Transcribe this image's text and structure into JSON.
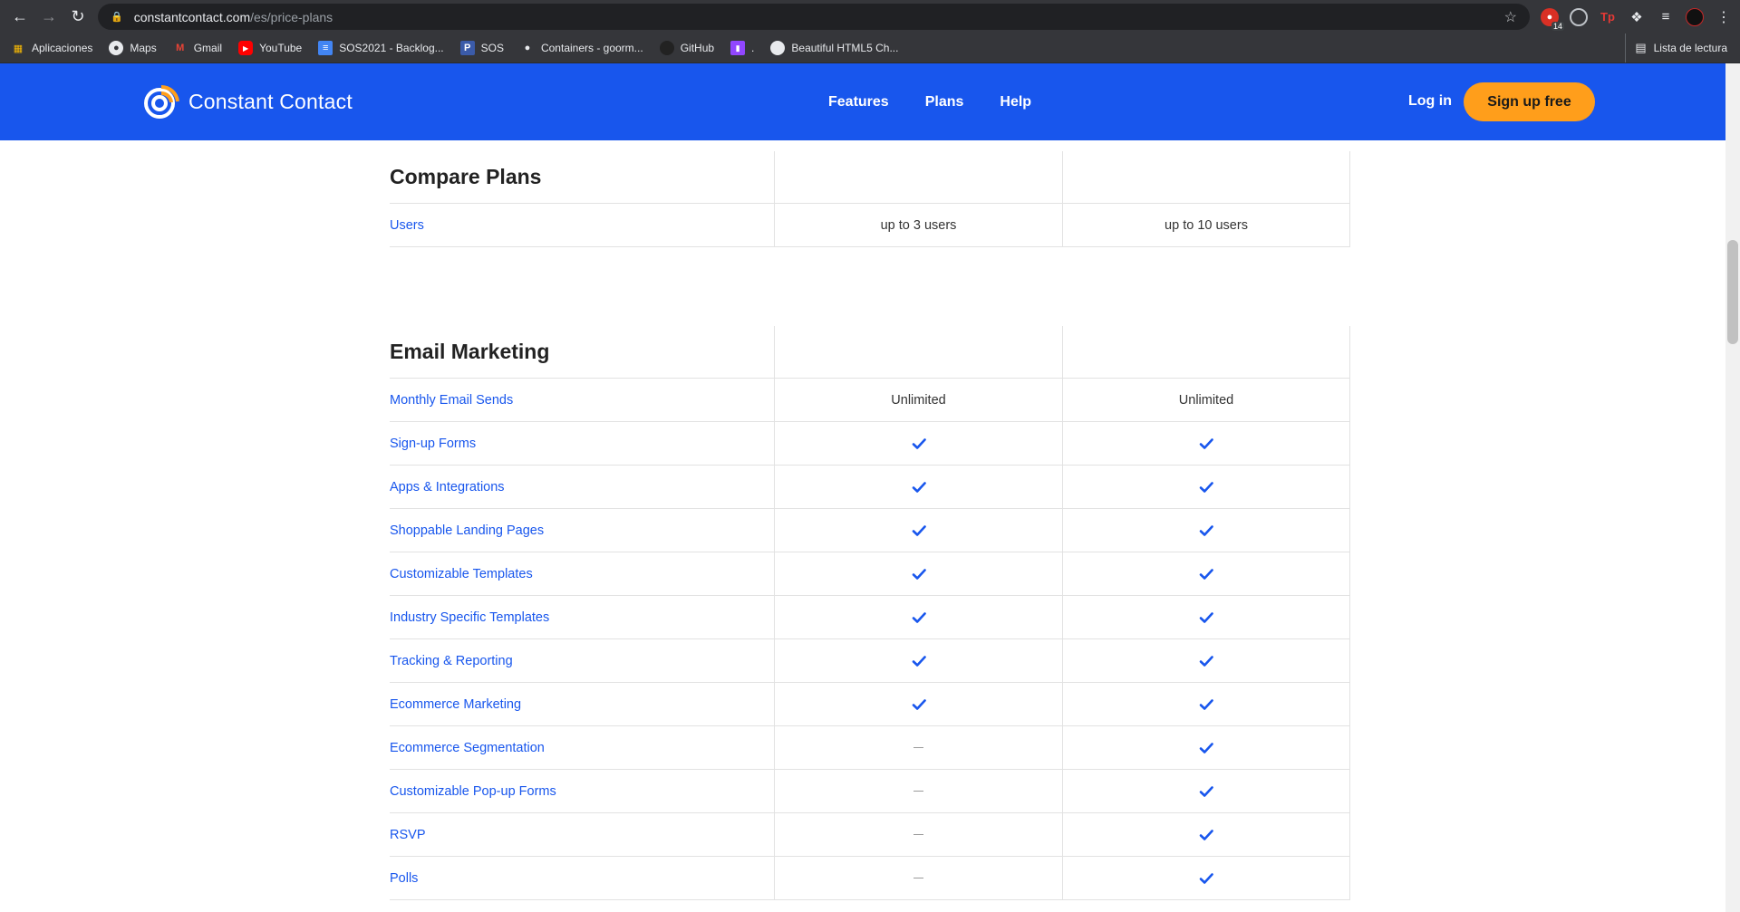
{
  "browser": {
    "url_host": "constantcontact.com",
    "url_path": "/es/price-plans",
    "bookmarks": [
      {
        "label": "Aplicaciones",
        "icon": "apps-grid-icon"
      },
      {
        "label": "Maps",
        "icon": "maps-icon"
      },
      {
        "label": "Gmail",
        "icon": "gmail-icon"
      },
      {
        "label": "YouTube",
        "icon": "youtube-icon"
      },
      {
        "label": "SOS2021 - Backlog...",
        "icon": "doc-icon"
      },
      {
        "label": "SOS",
        "icon": "p-icon"
      },
      {
        "label": "Containers - goorm...",
        "icon": "person-icon"
      },
      {
        "label": "GitHub",
        "icon": "github-icon"
      },
      {
        "label": ".",
        "icon": "twitch-icon"
      },
      {
        "label": "Beautiful HTML5 Ch...",
        "icon": "globe-icon"
      }
    ],
    "extension_badge": "14",
    "reading_list": "Lista de lectura"
  },
  "header": {
    "brand": "Constant Contact",
    "nav": [
      "Features",
      "Plans",
      "Help"
    ],
    "login": "Log in",
    "signup": "Sign up free"
  },
  "compare": {
    "title": "Compare Plans",
    "rows": [
      {
        "label": "Users",
        "col1": "up to 3 users",
        "col2": "up to 10 users"
      }
    ]
  },
  "email_marketing": {
    "title": "Email Marketing",
    "rows": [
      {
        "label": "Monthly Email Sends",
        "col1": "Unlimited",
        "col2": "Unlimited"
      },
      {
        "label": "Sign-up Forms",
        "col1": "check",
        "col2": "check"
      },
      {
        "label": "Apps & Integrations",
        "col1": "check",
        "col2": "check"
      },
      {
        "label": "Shoppable Landing Pages",
        "col1": "check",
        "col2": "check"
      },
      {
        "label": "Customizable Templates",
        "col1": "check",
        "col2": "check"
      },
      {
        "label": "Industry Specific Templates",
        "col1": "check",
        "col2": "check"
      },
      {
        "label": "Tracking & Reporting",
        "col1": "check",
        "col2": "check"
      },
      {
        "label": "Ecommerce Marketing",
        "col1": "check",
        "col2": "check"
      },
      {
        "label": "Ecommerce Segmentation",
        "col1": "dash",
        "col2": "check"
      },
      {
        "label": "Customizable Pop-up Forms",
        "col1": "dash",
        "col2": "check"
      },
      {
        "label": "RSVP",
        "col1": "dash",
        "col2": "check"
      },
      {
        "label": "Polls",
        "col1": "dash",
        "col2": "check"
      }
    ]
  },
  "colors": {
    "brand_blue": "#1856ed",
    "cta_orange": "#ff9e1b",
    "check_blue": "#1856ed"
  }
}
